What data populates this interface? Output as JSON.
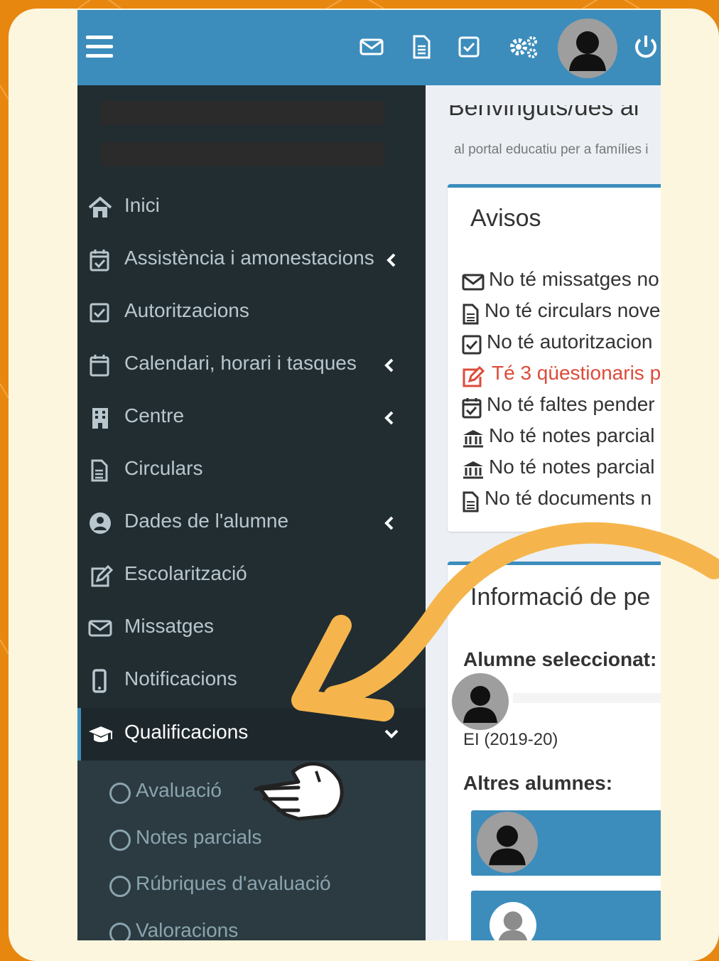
{
  "sidebar": {
    "items": [
      {
        "label": "Inici",
        "icon": "home-icon"
      },
      {
        "label": "Assistència i amonestacions",
        "icon": "calendar-check-icon"
      },
      {
        "label": "Autoritzacions",
        "icon": "checkbox-icon"
      },
      {
        "label": "Calendari, horari i tasques",
        "icon": "calendar-icon"
      },
      {
        "label": "Centre",
        "icon": "building-icon"
      },
      {
        "label": "Circulars",
        "icon": "document-icon"
      },
      {
        "label": "Dades de l'alumne",
        "icon": "user-circle-icon"
      },
      {
        "label": "Escolarització",
        "icon": "edit-icon"
      },
      {
        "label": "Missatges",
        "icon": "envelope-icon"
      },
      {
        "label": "Notificacions",
        "icon": "mobile-icon"
      },
      {
        "label": "Qualificacions",
        "icon": "graduation-cap-icon"
      }
    ],
    "submenu": [
      {
        "label": "Avaluació"
      },
      {
        "label": "Notes parcials"
      },
      {
        "label": "Rúbriques d'avaluació"
      },
      {
        "label": "Valoracions"
      }
    ]
  },
  "content": {
    "subheading": "al portal educatiu per a famílies i",
    "avisos": {
      "title": "Avisos",
      "notices": [
        {
          "text": "No té missatges no",
          "icon": "envelope-icon"
        },
        {
          "text": "No té circulars nove",
          "icon": "document-icon"
        },
        {
          "text": "No té autoritzacion",
          "icon": "checkbox-icon"
        },
        {
          "text": "Té 3 qüestionaris p",
          "icon": "edit-icon",
          "color": "#dd4b39"
        },
        {
          "text": "No té faltes pender",
          "icon": "calendar-check-icon"
        },
        {
          "text": "No té notes parcial",
          "icon": "institution-icon"
        },
        {
          "text": "No té notes parcial",
          "icon": "institution-icon"
        },
        {
          "text": "No té documents n",
          "icon": "document-icon"
        }
      ]
    },
    "info": {
      "title": "Informació de pe",
      "selected_label": "Alumne seleccionat:",
      "course": "EI (2019-20)",
      "others_label": "Altres alumnes:"
    }
  },
  "colors": {
    "frame": "#e8870f",
    "card": "#fdf6df",
    "topbar": "#3c8dbc",
    "sidebar": "#222d32",
    "arrow": "#f6b54c"
  }
}
